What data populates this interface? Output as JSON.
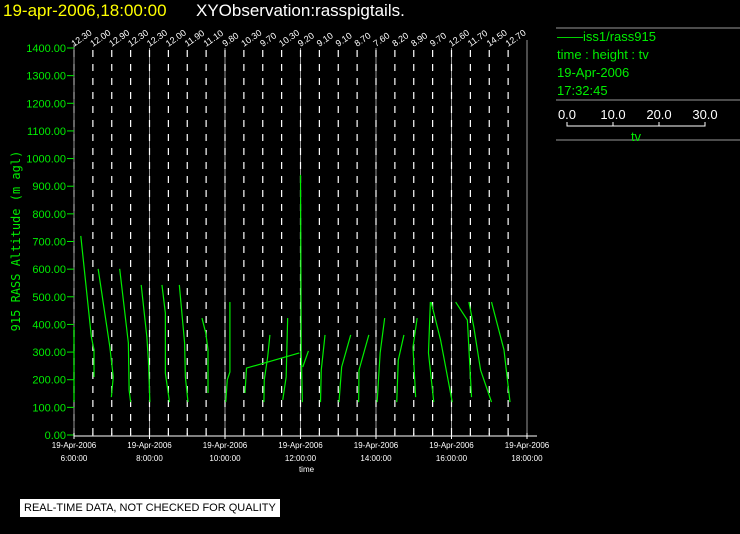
{
  "header": {
    "date_time": "19-apr-2006,18:00:00",
    "observation": "XYObservation:rasspigtails."
  },
  "legend": {
    "series": "iss1/rass915",
    "variables": "time : height : tv",
    "date": "19-Apr-2006",
    "time": "17:32:45",
    "scale_ticks": [
      "0.0",
      "10.0",
      "20.0",
      "30.0"
    ],
    "scale_label": "tv"
  },
  "disclaimer": "REAL-TIME DATA, NOT CHECKED FOR QUALITY",
  "colors": {
    "trace": "#00ee00",
    "axis": "#ffffff",
    "grid": "#999999",
    "title_date": "#ffff00"
  },
  "chart_data": {
    "type": "line",
    "title": "",
    "xlabel": "time",
    "ylabel": "915 RASS Altitude (m agl)",
    "xlim_hours": [
      6,
      18
    ],
    "ylim": [
      0,
      1400
    ],
    "y_ticks": [
      "0.00",
      "100.00",
      "200.00",
      "300.00",
      "400.00",
      "500.00",
      "600.00",
      "700.00",
      "800.00",
      "900.00",
      "1000.00",
      "1100.00",
      "1200.00",
      "1300.00",
      "1400.00"
    ],
    "x_ticks": [
      {
        "hour": 6,
        "date": "19-Apr-2006",
        "time": "6:00:00"
      },
      {
        "hour": 8,
        "date": "19-Apr-2006",
        "time": "8:00:00"
      },
      {
        "hour": 10,
        "date": "19-Apr-2006",
        "time": "10:00:00"
      },
      {
        "hour": 12,
        "date": "19-Apr-2006",
        "time": "12:00:00"
      },
      {
        "hour": 14,
        "date": "19-Apr-2006",
        "time": "14:00:00"
      },
      {
        "hour": 16,
        "date": "19-Apr-2006",
        "time": "16:00:00"
      },
      {
        "hour": 18,
        "date": "19-Apr-2006",
        "time": "18:00:00"
      }
    ],
    "profile_start_hour": 6,
    "profile_interval_hours": 0.5,
    "profile_labels": [
      "12.30",
      "12.00",
      "12.90",
      "12.30",
      "12.30",
      "12.00",
      "11.90",
      "11.10",
      "9.80",
      "10.30",
      "9.70",
      "10.30",
      "9.20",
      "9.10",
      "9.10",
      "8.70",
      "7.60",
      "8.20",
      "8.90",
      "9.70",
      "12.60",
      "11.70",
      "14.50",
      "12.70"
    ],
    "traces": [
      [
        [
          6.0,
          391
        ],
        [
          6.0,
          119
        ]
      ],
      [
        [
          6.18,
          720
        ],
        [
          6.46,
          355
        ],
        [
          6.53,
          308
        ],
        [
          6.53,
          210
        ]
      ],
      [
        [
          6.64,
          601
        ],
        [
          6.95,
          318
        ],
        [
          7.04,
          210
        ],
        [
          6.99,
          137
        ]
      ],
      [
        [
          7.21,
          601
        ],
        [
          7.44,
          333
        ],
        [
          7.46,
          163
        ],
        [
          7.5,
          119
        ]
      ],
      [
        [
          7.78,
          543
        ],
        [
          7.93,
          355
        ],
        [
          7.97,
          271
        ],
        [
          8.01,
          119
        ]
      ],
      [
        [
          8.33,
          543
        ],
        [
          8.42,
          441
        ],
        [
          8.42,
          224
        ],
        [
          8.53,
          119
        ]
      ],
      [
        [
          8.79,
          543
        ],
        [
          8.93,
          333
        ],
        [
          8.95,
          210
        ],
        [
          9.02,
          119
        ]
      ],
      [
        [
          9.39,
          423
        ],
        [
          9.49,
          369
        ],
        [
          9.55,
          308
        ],
        [
          9.55,
          152
        ]
      ],
      [
        [
          10.02,
          119
        ],
        [
          10.06,
          199
        ],
        [
          10.13,
          228
        ],
        [
          10.13,
          481
        ]
      ],
      [
        [
          10.53,
          152
        ],
        [
          10.57,
          242
        ],
        [
          11.97,
          297
        ]
      ],
      [
        [
          11.03,
          119
        ],
        [
          11.04,
          199
        ],
        [
          11.13,
          282
        ],
        [
          11.19,
          362
        ]
      ],
      [
        [
          11.53,
          127
        ],
        [
          11.62,
          210
        ],
        [
          11.66,
          423
        ]
      ],
      [
        [
          12.0,
          941
        ],
        [
          12.02,
          300
        ],
        [
          12.05,
          119
        ]
      ],
      [
        [
          12.06,
          246
        ],
        [
          12.21,
          304
        ]
      ],
      [
        [
          12.53,
          119
        ],
        [
          12.55,
          235
        ],
        [
          12.65,
          362
        ]
      ],
      [
        [
          13.02,
          119
        ],
        [
          13.09,
          246
        ],
        [
          13.33,
          362
        ]
      ],
      [
        [
          13.54,
          119
        ],
        [
          13.55,
          235
        ],
        [
          13.81,
          362
        ]
      ],
      [
        [
          14.03,
          119
        ],
        [
          14.11,
          297
        ],
        [
          14.23,
          423
        ]
      ],
      [
        [
          14.55,
          119
        ],
        [
          14.59,
          271
        ],
        [
          14.74,
          362
        ]
      ],
      [
        [
          15.05,
          137
        ],
        [
          14.98,
          318
        ],
        [
          15.09,
          423
        ]
      ],
      [
        [
          15.44,
          481
        ],
        [
          15.39,
          297
        ],
        [
          15.53,
          119
        ]
      ],
      [
        [
          15.46,
          481
        ],
        [
          15.71,
          344
        ],
        [
          16.02,
          119
        ]
      ],
      [
        [
          16.11,
          481
        ],
        [
          16.42,
          416
        ],
        [
          16.53,
          137
        ]
      ],
      [
        [
          16.46,
          481
        ],
        [
          16.59,
          391
        ],
        [
          16.77,
          235
        ],
        [
          17.06,
          119
        ]
      ],
      [
        [
          17.06,
          481
        ],
        [
          17.39,
          308
        ],
        [
          17.55,
          119
        ]
      ]
    ]
  }
}
